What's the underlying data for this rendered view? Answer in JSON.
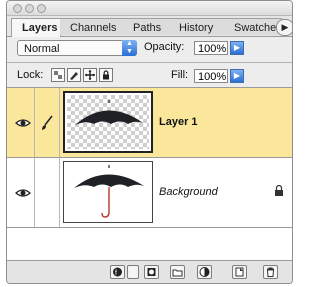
{
  "tabs": [
    {
      "label": "Layers",
      "active": true
    },
    {
      "label": "Channels",
      "active": false
    },
    {
      "label": "Paths",
      "active": false
    },
    {
      "label": "History",
      "active": false
    },
    {
      "label": "Swatches",
      "active": false
    }
  ],
  "panel_menu_icon": "triangle-right-icon",
  "blend_mode": {
    "value": "Normal"
  },
  "opacity": {
    "label": "Opacity:",
    "value": "100%"
  },
  "fill": {
    "label": "Fill:",
    "value": "100%"
  },
  "lock": {
    "label": "Lock:",
    "icons": [
      "lock-transparent-icon",
      "lock-image-icon",
      "lock-position-icon",
      "lock-all-icon"
    ]
  },
  "layers": [
    {
      "name": "Layer 1",
      "visible": true,
      "selected": true,
      "linked_icon": "paintbrush-icon",
      "locked": false
    },
    {
      "name": "Background",
      "visible": true,
      "selected": false,
      "linked_icon": "",
      "locked": true
    }
  ],
  "bottom_icons": [
    "link-layers-icon",
    "layer-style-icon",
    "layer-mask-icon",
    "new-group-icon",
    "adjustment-layer-icon",
    "new-layer-icon",
    "delete-layer-icon"
  ],
  "colors": {
    "selected_row": "#fbe79c",
    "accent": "#2a6fd6"
  }
}
